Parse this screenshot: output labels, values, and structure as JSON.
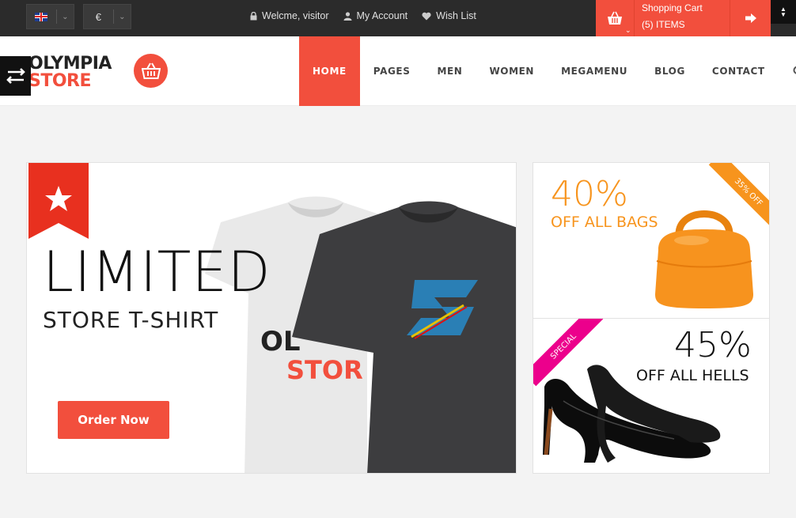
{
  "topbar": {
    "language_label": "EN",
    "currency_symbol": "€",
    "welcome": "Welcme, visitor",
    "account": "My Account",
    "wishlist": "Wish List",
    "cart_title": "Shopping Cart",
    "cart_items": "(5) ITEMS"
  },
  "logo": {
    "line1": "OLYMPIA",
    "line2": "STORE"
  },
  "nav": {
    "items": [
      {
        "label": "HOME",
        "active": true
      },
      {
        "label": "PAGES",
        "active": false
      },
      {
        "label": "MEN",
        "active": false
      },
      {
        "label": "WOMEN",
        "active": false
      },
      {
        "label": "MEGAMENU",
        "active": false
      },
      {
        "label": "BLOG",
        "active": false
      },
      {
        "label": "CONTACT",
        "active": false
      }
    ]
  },
  "hero": {
    "title": "LIMITED",
    "subtitle": "STORE T-SHIRT",
    "button": "Order Now",
    "shirt_print_1": "OL",
    "shirt_print_2": "STOR"
  },
  "banners": {
    "bags": {
      "percent": "40%",
      "text": "OFF ALL BAGS",
      "corner": "35% OFF"
    },
    "heels": {
      "percent": "45%",
      "text": "OFF ALL HELLS",
      "corner": "SPECIAL"
    }
  },
  "colors": {
    "accent": "#f24f3d",
    "bags_orange": "#f7941d",
    "special_pink": "#ec008c",
    "dark": "#2b2b2b"
  },
  "icons": [
    "flag-uk-icon",
    "chevron-down-icon",
    "lock-icon",
    "user-icon",
    "heart-icon",
    "basket-icon",
    "arrow-right-icon",
    "search-icon",
    "switch-arrows-icon",
    "star-icon"
  ]
}
